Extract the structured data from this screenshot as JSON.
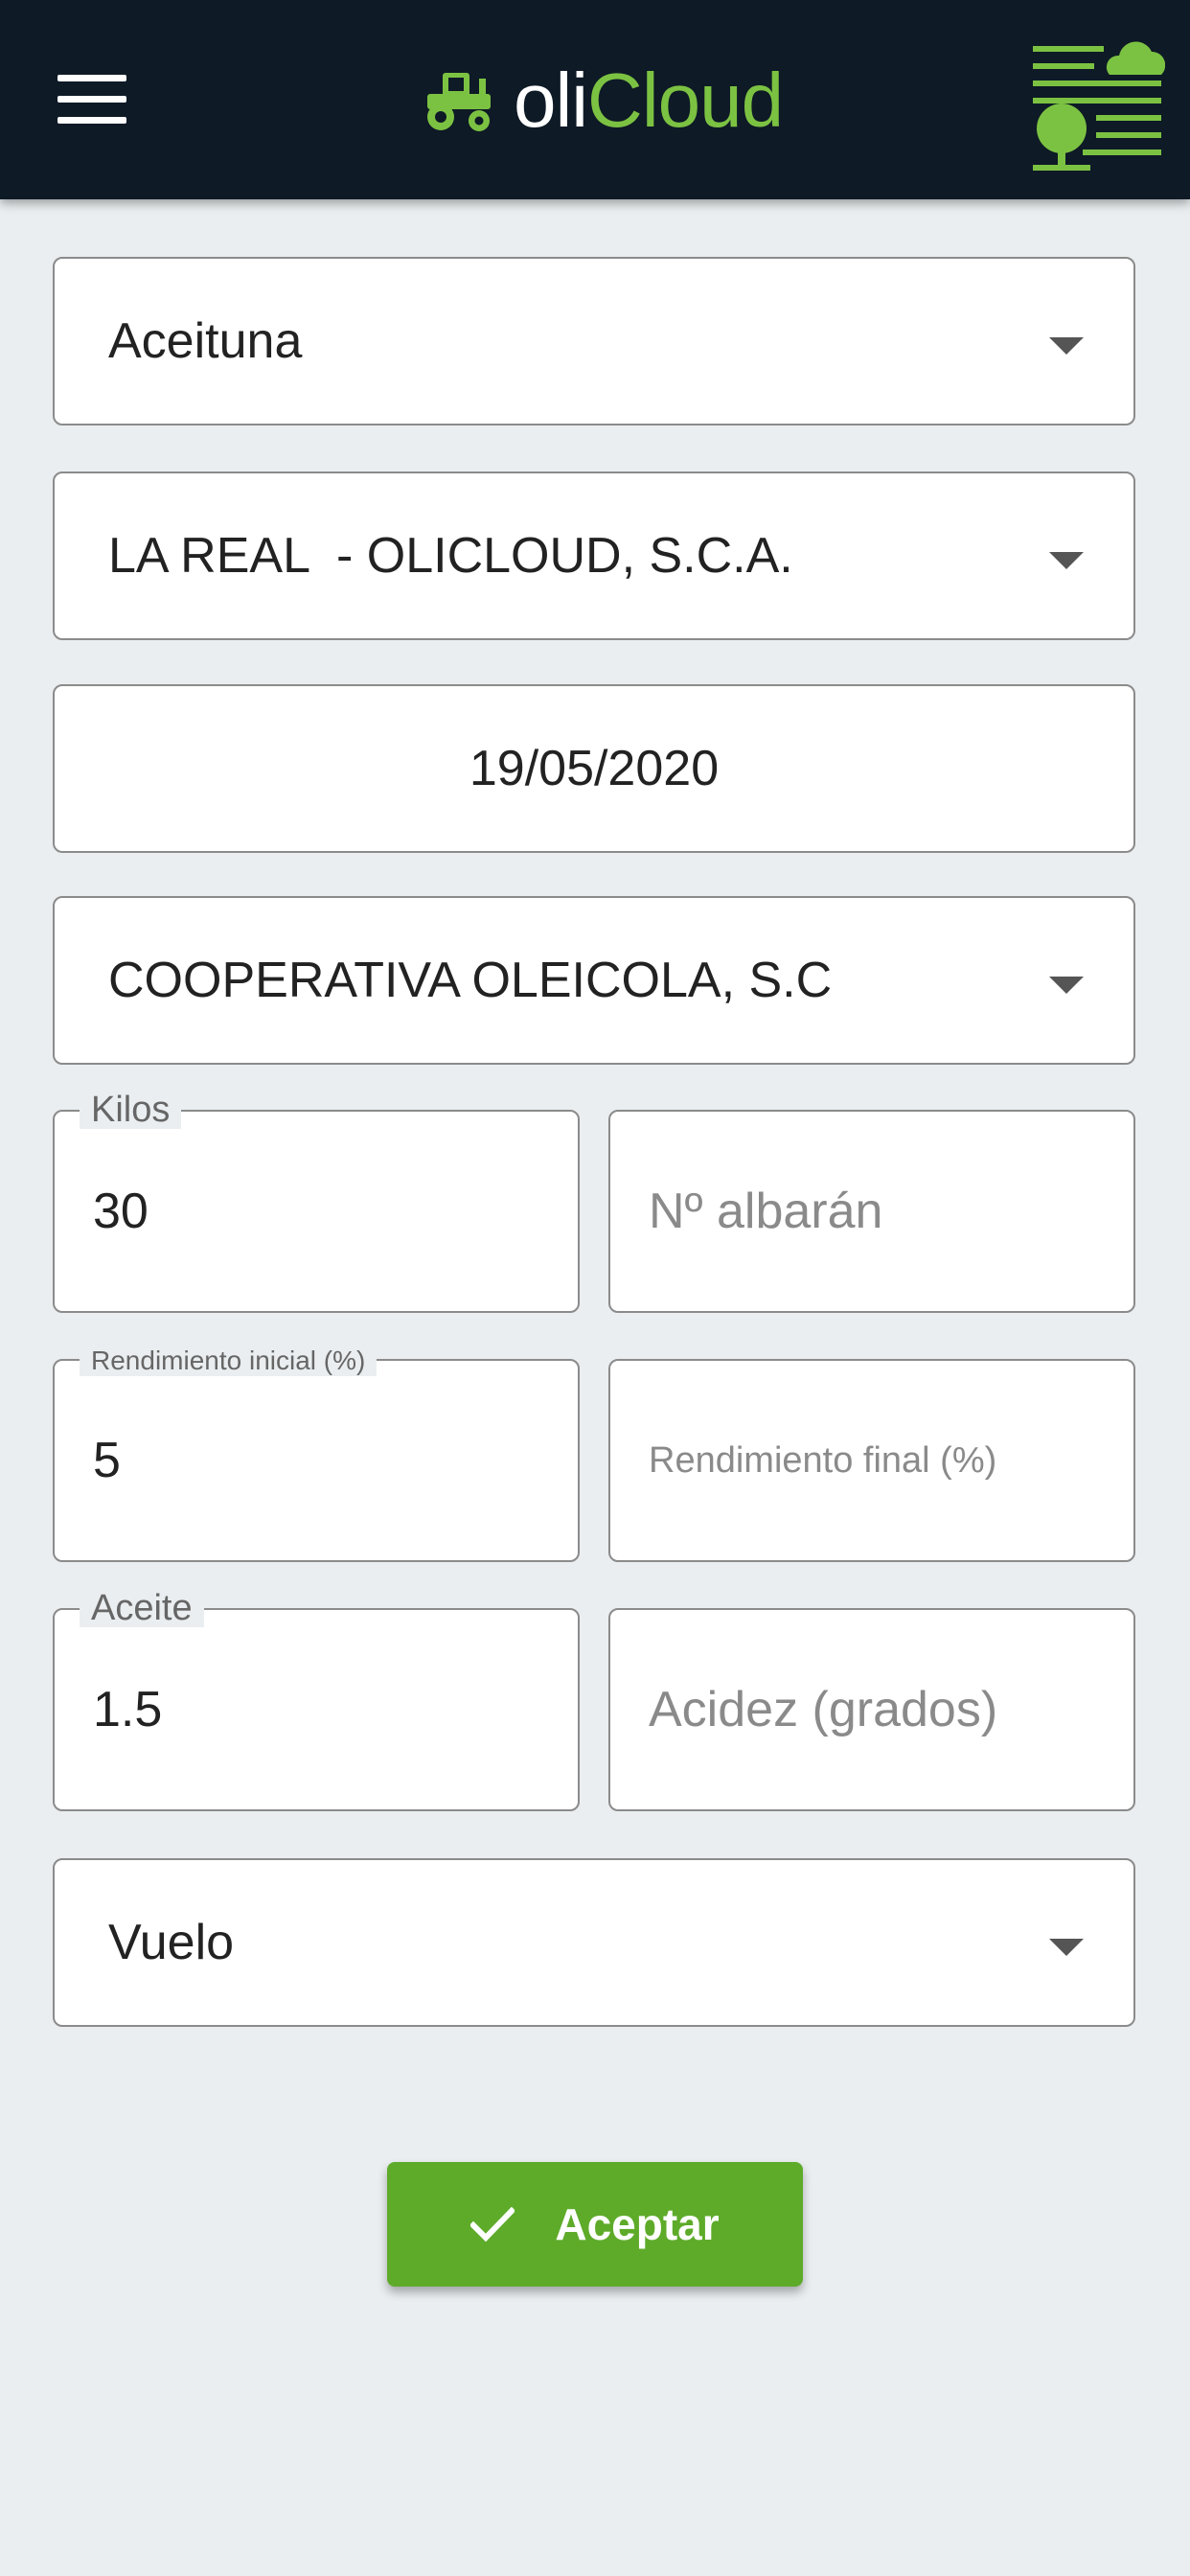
{
  "header": {
    "brand_part1": "oli",
    "brand_part2": "Cloud",
    "menu_icon": "hamburger-menu-icon",
    "brand_icon": "tractor-icon",
    "field_logo_icon": "trees-field-logo-icon",
    "colors": {
      "background": "#0e1a26",
      "accent": "#7cc242"
    }
  },
  "form": {
    "product_select": "Aceituna",
    "farm_select": "LA REAL  - OLICLOUD, S.C.A.",
    "date": "19/05/2020",
    "buyer_select": "COOPERATIVA OLEICOLA, S.C",
    "kilos": {
      "label": "Kilos",
      "value": "30"
    },
    "albaran": {
      "placeholder": "Nº albarán"
    },
    "rendimiento_inicial": {
      "label": "Rendimiento inicial (%)",
      "value": "5"
    },
    "rendimiento_final": {
      "placeholder": "Rendimiento final (%)"
    },
    "aceite": {
      "label": "Aceite",
      "value": "1.5"
    },
    "acidez": {
      "placeholder": "Acidez (grados)"
    },
    "type_select": "Vuelo"
  },
  "actions": {
    "accept_label": "Aceptar",
    "accept_icon": "check-icon",
    "accept_color": "#5eab2a"
  }
}
